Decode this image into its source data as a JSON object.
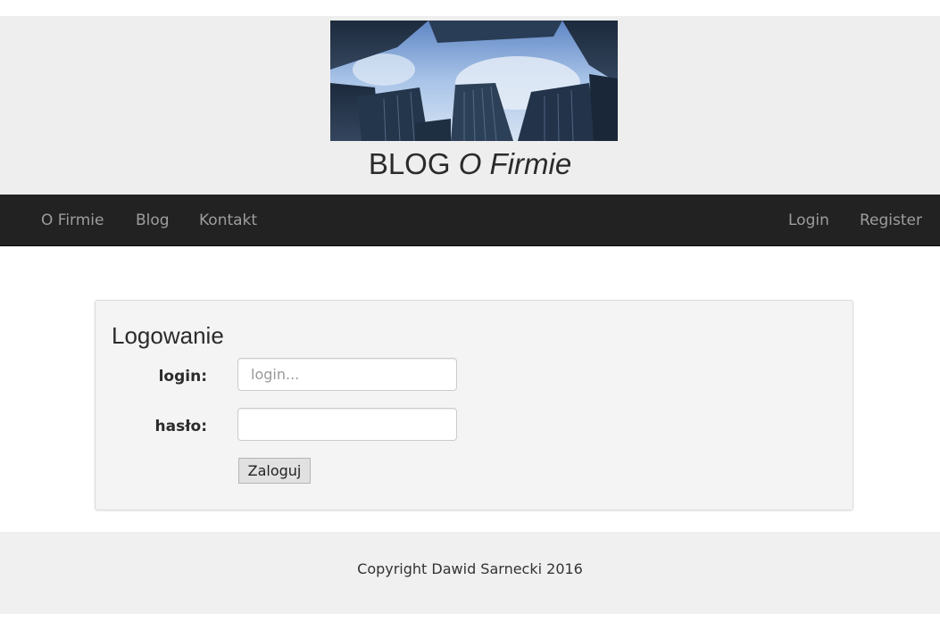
{
  "header": {
    "banner_image": "skyscrapers-looking-up",
    "title_prefix": "BLOG",
    "title_emphasis": "O Firmie"
  },
  "nav": {
    "left": [
      "O Firmie",
      "Blog",
      "Kontakt"
    ],
    "right": [
      "Login",
      "Register"
    ]
  },
  "login_form": {
    "title": "Logowanie",
    "login_label": "login:",
    "login_placeholder": "login...",
    "login_value": "",
    "password_label": "hasło:",
    "password_value": "",
    "submit_label": "Zaloguj"
  },
  "footer": {
    "copyright": "Copyright Dawid Sarnecki 2016"
  },
  "colors": {
    "header_bg": "#eeeeee",
    "navbar_bg": "#222222",
    "nav_link": "#9d9d9d",
    "panel_bg": "#f4f4f4",
    "footer_bg": "#f0f0f0"
  }
}
